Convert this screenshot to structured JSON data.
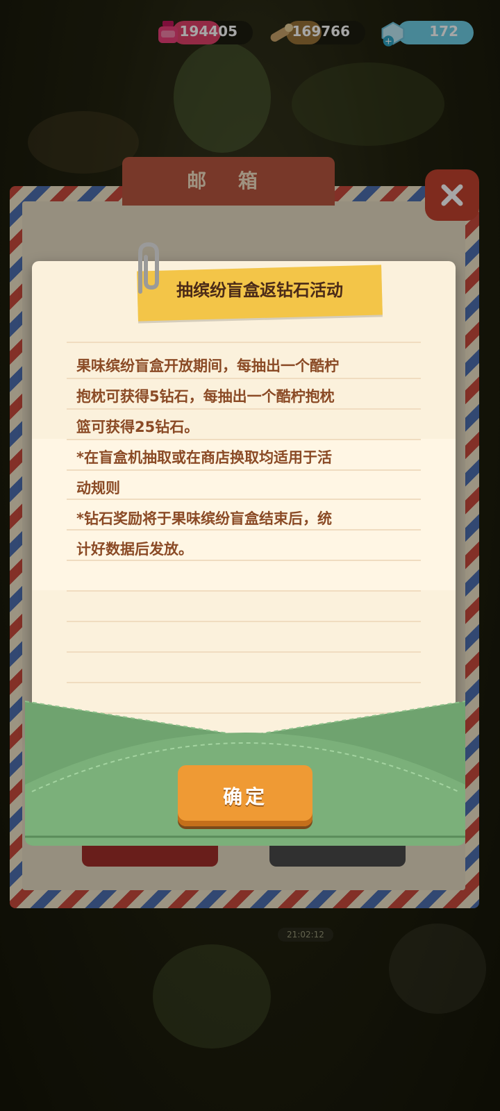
{
  "currencies": [
    {
      "name": "ink",
      "value": "194405",
      "color": "#e2416b",
      "fill_fraction": 0.6
    },
    {
      "name": "wood",
      "value": "169766",
      "color": "#9a7438",
      "fill_fraction": 0.45
    },
    {
      "name": "diamond",
      "value": "172",
      "color": "#6fd0e6",
      "fill_fraction": 1.0
    }
  ],
  "mailbox": {
    "tab_title": "邮 箱",
    "timer": "21:02:12"
  },
  "letter": {
    "title": "抽缤纷盲盒返钻石活动",
    "body": "果味缤纷盲盒开放期间，每抽出一个酷柠\n抱枕可获得5钻石，每抽出一个酷柠抱枕\n篮可获得25钻石。\n*在盲盒机抽取或在商店换取均适用于活\n动规则\n*钻石奖励将于果味缤纷盲盒结束后，统\n计好数据后发放。"
  },
  "buttons": {
    "confirm_label": "确定"
  },
  "colors": {
    "accent": "#ef9a34",
    "tape": "#f3c548",
    "envelope": "#6fa36f",
    "text": "#8a4a25"
  }
}
